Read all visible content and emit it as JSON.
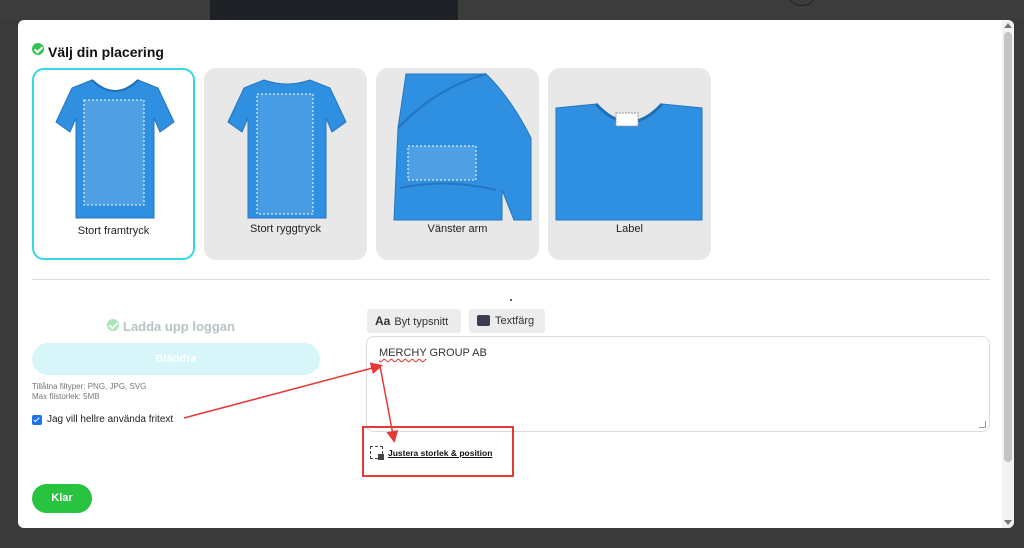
{
  "colors": {
    "shirt": "#2f8fe0",
    "selected_border": "#35d6e6",
    "green": "#33c452",
    "annotation_red": "#e53935"
  },
  "placement": {
    "title": "Välj din placering",
    "check_icon": "check-circle-icon",
    "selected_index": 0,
    "options": [
      {
        "label": "Stort framtryck",
        "view": "front-shirt"
      },
      {
        "label": "Stort ryggtryck",
        "view": "back-shirt"
      },
      {
        "label": "Vänster arm",
        "view": "sleeve-closeup"
      },
      {
        "label": "Label",
        "view": "neck-label-closeup"
      }
    ]
  },
  "upload": {
    "title": "Ladda upp loggan",
    "browse_label": "Bläddra",
    "filetypes_text": "Tillåtna filtyper: PNG, JPG, SVG",
    "maxsize_text": "Max filstorlek: 5MB",
    "freetext_checkbox_label": "Jag vill hellre använda fritext",
    "freetext_checked": true
  },
  "text_tools": {
    "font_button_icon_text": "Aa",
    "font_button_label": "Byt typsnitt",
    "color_button_label": "Textfärg",
    "text_color": "#3a3c52",
    "text_value_word1": "MERCHY",
    "text_value_rest": " GROUP AB",
    "adjust_link_label": "Justera storlek & position",
    "adjust_icon": "resize-position-icon"
  },
  "actions": {
    "done_label": "Klar"
  }
}
